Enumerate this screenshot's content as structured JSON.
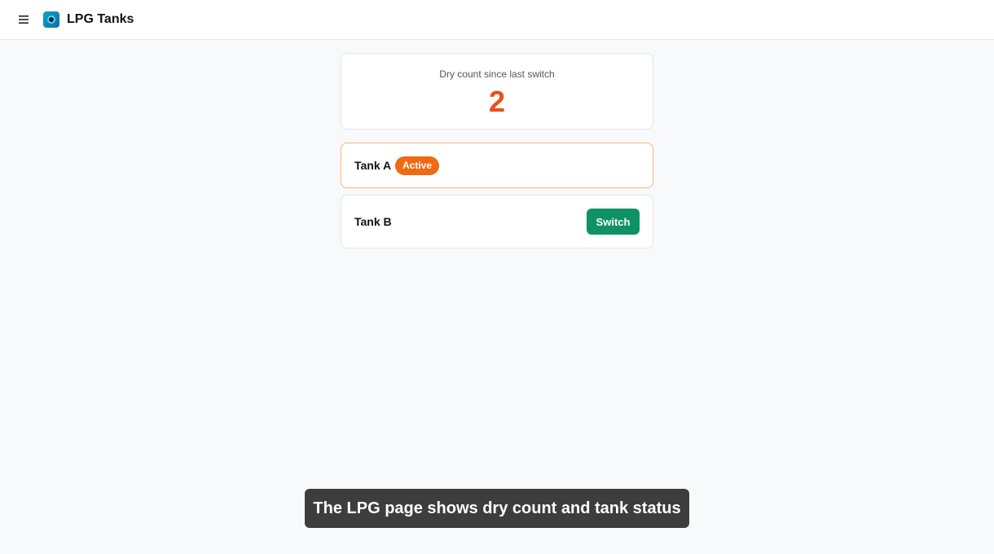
{
  "header": {
    "menu_icon": "hamburger-menu-icon",
    "logo_icon": "app-logo-icon",
    "title": "LPG Tanks"
  },
  "dry_count": {
    "label": "Dry count since last switch",
    "value": "2",
    "value_color": "#e5511a"
  },
  "tanks": [
    {
      "name": "Tank A",
      "status_badge": "Active",
      "badge_color": "#f06a12",
      "border_color": "#f5b877"
    },
    {
      "name": "Tank B",
      "action_label": "Switch",
      "action_color": "#0f9265"
    }
  ],
  "caption": "The LPG page shows dry count and tank status"
}
